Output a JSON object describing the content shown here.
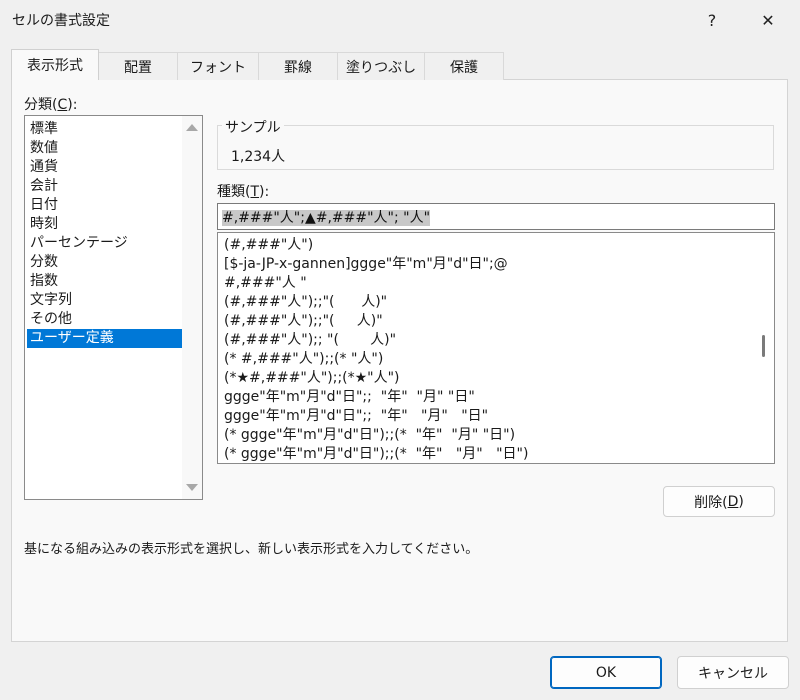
{
  "window": {
    "title": "セルの書式設定",
    "help_label": "?",
    "close_label": "✕"
  },
  "tabs": [
    {
      "label": "表示形式",
      "active": true
    },
    {
      "label": "配置",
      "active": false
    },
    {
      "label": "フォント",
      "active": false
    },
    {
      "label": "罫線",
      "active": false
    },
    {
      "label": "塗りつぶし",
      "active": false
    },
    {
      "label": "保護",
      "active": false
    }
  ],
  "category": {
    "label_pre": "分類(",
    "label_key": "C",
    "label_post": "):",
    "items": [
      "標準",
      "数値",
      "通貨",
      "会計",
      "日付",
      "時刻",
      "パーセンテージ",
      "分数",
      "指数",
      "文字列",
      "その他",
      "ユーザー定義"
    ],
    "selected": "ユーザー定義"
  },
  "sample": {
    "legend": "サンプル",
    "value": "1,234人"
  },
  "type": {
    "label_pre": "種類(",
    "label_key": "T",
    "label_post": "):",
    "input_value": "#,###\"人\";▲#,###\"人\"; \"人\"",
    "formats": [
      "(#,###\"人\")",
      "[$-ja-JP-x-gannen]ggge\"年\"m\"月\"d\"日\";@",
      "#,###\"人 \"",
      "(#,###\"人\");;\"(      人)\"",
      "(#,###\"人\");;\"(     人)\"",
      "(#,###\"人\");; \"(       人)\"",
      "(* #,###\"人\");;(* \"人\")",
      "(*★#,###\"人\");;(*★\"人\")",
      "ggge\"年\"m\"月\"d\"日\";;  \"年\"  \"月\" \"日\"",
      "ggge\"年\"m\"月\"d\"日\";;  \"年\"   \"月\"   \"日\"",
      "(* ggge\"年\"m\"月\"d\"日\");;(*  \"年\"  \"月\" \"日\")",
      "(* ggge\"年\"m\"月\"d\"日\");;(*  \"年\"   \"月\"   \"日\")"
    ]
  },
  "delete_button": {
    "pre": "削除(",
    "key": "D",
    "post": ")"
  },
  "description": "基になる組み込みの表示形式を選択し、新しい表示形式を入力してください。",
  "footer": {
    "ok_label": "OK",
    "cancel_label": "キャンセル"
  },
  "colors": {
    "accent": "#0078d7",
    "primary_border": "#0067c0",
    "panel_bg": "#f9f9f9",
    "dialog_bg": "#f0f0f0"
  }
}
